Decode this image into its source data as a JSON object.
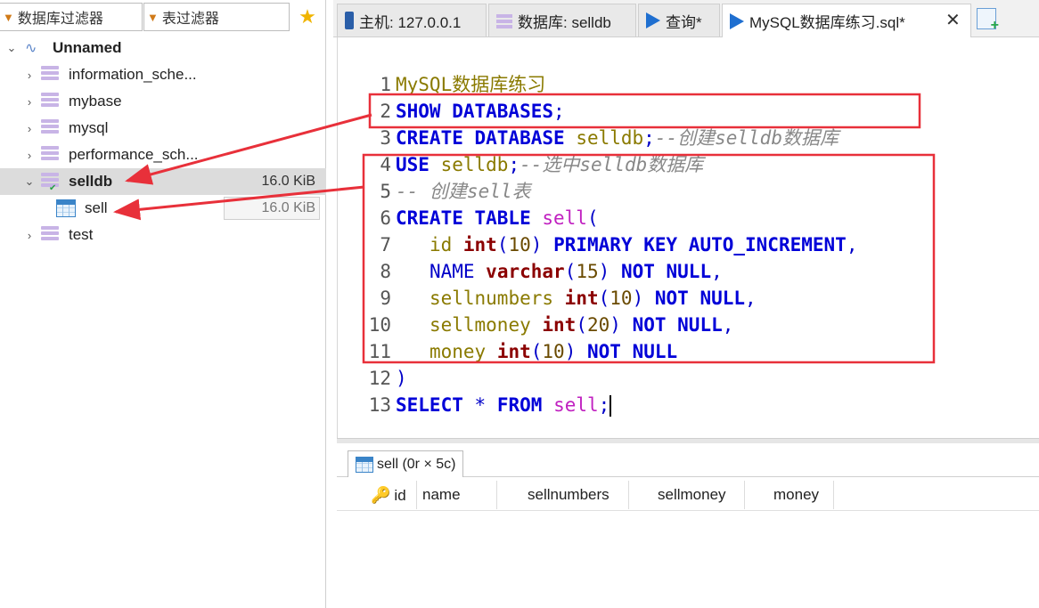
{
  "filters": {
    "db_filter_label": "数据库过滤器",
    "table_filter_label": "表过滤器"
  },
  "tree": {
    "root_label": "Unnamed",
    "databases": [
      {
        "name": "information_sche..."
      },
      {
        "name": "mybase"
      },
      {
        "name": "mysql"
      },
      {
        "name": "performance_sch..."
      },
      {
        "name": "selldb",
        "size": "16.0 KiB",
        "selected": true
      },
      {
        "name": "test"
      }
    ],
    "table": {
      "name": "sell",
      "size": "16.0 KiB"
    }
  },
  "tabs": {
    "host": "主机: 127.0.0.1",
    "database": "数据库: selldb",
    "query": "查询*",
    "file": "MySQL数据库练习.sql*",
    "close_glyph": "✕"
  },
  "editor": {
    "line_numbers": [
      "1",
      "2",
      "3",
      "4",
      "5",
      "6",
      "7",
      "8",
      "9",
      "10",
      "11",
      "12",
      "13"
    ]
  },
  "result": {
    "tab_label": "sell (0r × 5c)",
    "columns": [
      "id",
      "name",
      "sellnumbers",
      "sellmoney",
      "money"
    ]
  },
  "colors": {
    "keyword": "#0000d8",
    "type": "#8b0000",
    "identifier": "#8a7a00",
    "table_name": "#c020c0",
    "comment": "#888888",
    "annotation_red": "#e8303a"
  }
}
